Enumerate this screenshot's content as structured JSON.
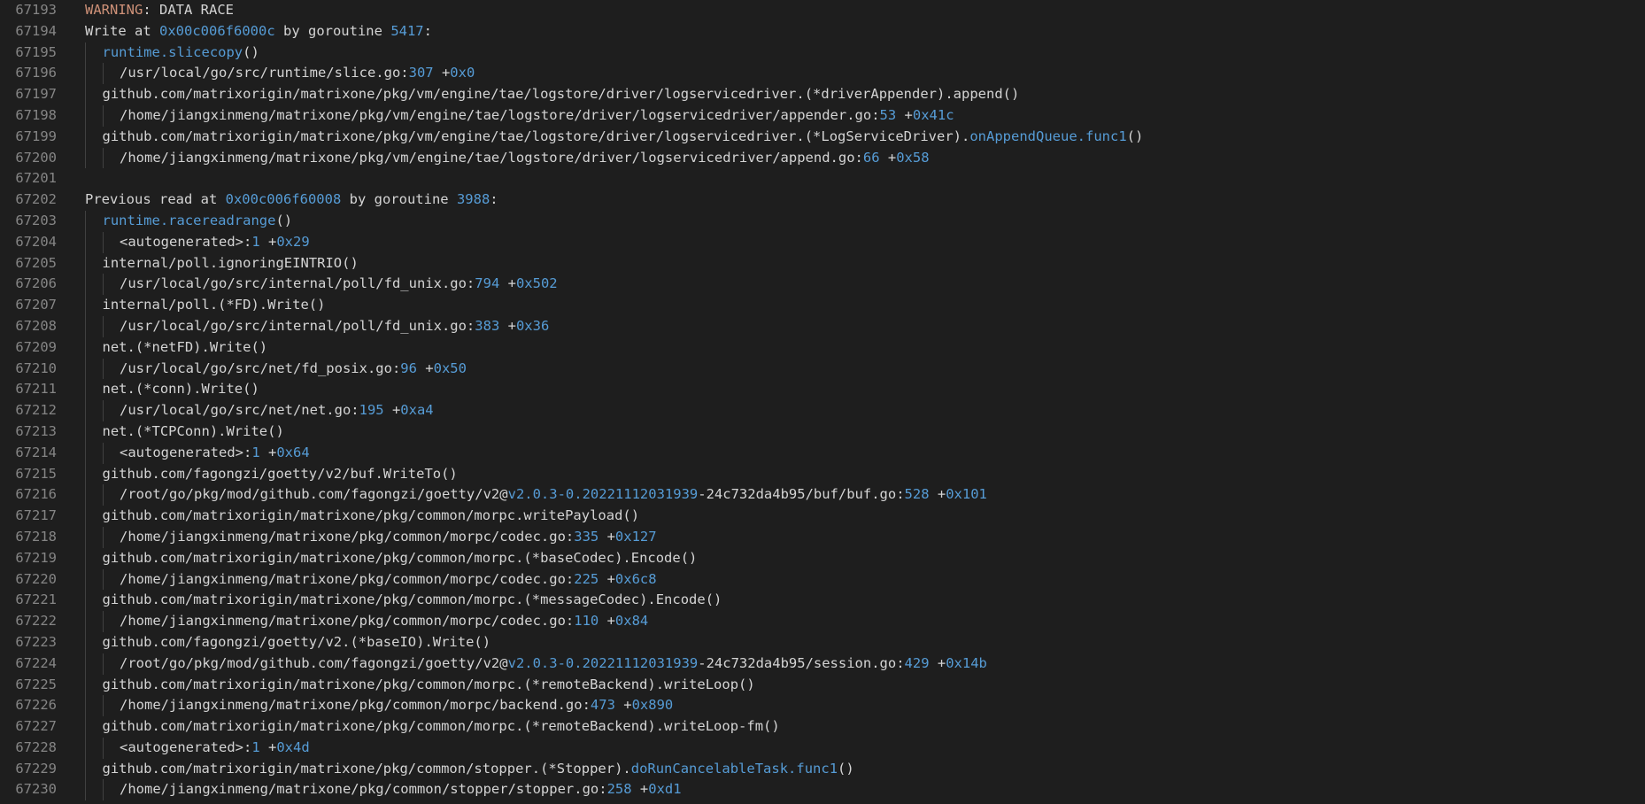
{
  "colors": {
    "background": "#1e1e1e",
    "text": "#d4d4d4",
    "line_number": "#858585",
    "highlight_blue": "#569cd6",
    "warning_orange": "#ce9178",
    "indent_guide": "#404040"
  },
  "lines": [
    {
      "n": "67193",
      "indent": 0,
      "seg": [
        {
          "t": "WARNING",
          "c": "orange"
        },
        {
          "t": ": DATA RACE",
          "c": "plain"
        }
      ]
    },
    {
      "n": "67194",
      "indent": 0,
      "seg": [
        {
          "t": "Write at ",
          "c": "plain"
        },
        {
          "t": "0x00c006f6000c",
          "c": "blue"
        },
        {
          "t": " by goroutine ",
          "c": "plain"
        },
        {
          "t": "5417",
          "c": "blue"
        },
        {
          "t": ":",
          "c": "plain"
        }
      ]
    },
    {
      "n": "67195",
      "indent": 1,
      "seg": [
        {
          "t": "runtime.slicecopy",
          "c": "blue"
        },
        {
          "t": "()",
          "c": "plain"
        }
      ]
    },
    {
      "n": "67196",
      "indent": 2,
      "seg": [
        {
          "t": "/usr/local/go/src/runtime/slice.go:",
          "c": "plain"
        },
        {
          "t": "307",
          "c": "blue"
        },
        {
          "t": " +",
          "c": "plain"
        },
        {
          "t": "0x0",
          "c": "blue"
        }
      ]
    },
    {
      "n": "67197",
      "indent": 1,
      "seg": [
        {
          "t": "github.com/matrixorigin/matrixone/pkg/vm/engine/tae/logstore/driver/logservicedriver.(*driverAppender).append()",
          "c": "plain"
        }
      ]
    },
    {
      "n": "67198",
      "indent": 2,
      "seg": [
        {
          "t": "/home/jiangxinmeng/matrixone/pkg/vm/engine/tae/logstore/driver/logservicedriver/appender.go:",
          "c": "plain"
        },
        {
          "t": "53",
          "c": "blue"
        },
        {
          "t": " +",
          "c": "plain"
        },
        {
          "t": "0x41c",
          "c": "blue"
        }
      ]
    },
    {
      "n": "67199",
      "indent": 1,
      "seg": [
        {
          "t": "github.com/matrixorigin/matrixone/pkg/vm/engine/tae/logstore/driver/logservicedriver.(*LogServiceDriver).",
          "c": "plain"
        },
        {
          "t": "onAppendQueue.func1",
          "c": "blue"
        },
        {
          "t": "()",
          "c": "plain"
        }
      ]
    },
    {
      "n": "67200",
      "indent": 2,
      "seg": [
        {
          "t": "/home/jiangxinmeng/matrixone/pkg/vm/engine/tae/logstore/driver/logservicedriver/append.go:",
          "c": "plain"
        },
        {
          "t": "66",
          "c": "blue"
        },
        {
          "t": " +",
          "c": "plain"
        },
        {
          "t": "0x58",
          "c": "blue"
        }
      ]
    },
    {
      "n": "67201",
      "indent": 0,
      "seg": []
    },
    {
      "n": "67202",
      "indent": 0,
      "seg": [
        {
          "t": "Previous read at ",
          "c": "plain"
        },
        {
          "t": "0x00c006f60008",
          "c": "blue"
        },
        {
          "t": " by goroutine ",
          "c": "plain"
        },
        {
          "t": "3988",
          "c": "blue"
        },
        {
          "t": ":",
          "c": "plain"
        }
      ]
    },
    {
      "n": "67203",
      "indent": 1,
      "seg": [
        {
          "t": "runtime.racereadrange",
          "c": "blue"
        },
        {
          "t": "()",
          "c": "plain"
        }
      ]
    },
    {
      "n": "67204",
      "indent": 2,
      "seg": [
        {
          "t": "<autogenerated>:",
          "c": "plain"
        },
        {
          "t": "1",
          "c": "blue"
        },
        {
          "t": " +",
          "c": "plain"
        },
        {
          "t": "0x29",
          "c": "blue"
        }
      ]
    },
    {
      "n": "67205",
      "indent": 1,
      "seg": [
        {
          "t": "internal/poll.ignoringEINTRIO()",
          "c": "plain"
        }
      ]
    },
    {
      "n": "67206",
      "indent": 2,
      "seg": [
        {
          "t": "/usr/local/go/src/internal/poll/fd_unix.go:",
          "c": "plain"
        },
        {
          "t": "794",
          "c": "blue"
        },
        {
          "t": " +",
          "c": "plain"
        },
        {
          "t": "0x502",
          "c": "blue"
        }
      ]
    },
    {
      "n": "67207",
      "indent": 1,
      "seg": [
        {
          "t": "internal/poll.(*FD).Write()",
          "c": "plain"
        }
      ]
    },
    {
      "n": "67208",
      "indent": 2,
      "seg": [
        {
          "t": "/usr/local/go/src/internal/poll/fd_unix.go:",
          "c": "plain"
        },
        {
          "t": "383",
          "c": "blue"
        },
        {
          "t": " +",
          "c": "plain"
        },
        {
          "t": "0x36",
          "c": "blue"
        }
      ]
    },
    {
      "n": "67209",
      "indent": 1,
      "seg": [
        {
          "t": "net.(*netFD).Write()",
          "c": "plain"
        }
      ]
    },
    {
      "n": "67210",
      "indent": 2,
      "seg": [
        {
          "t": "/usr/local/go/src/net/fd_posix.go:",
          "c": "plain"
        },
        {
          "t": "96",
          "c": "blue"
        },
        {
          "t": " +",
          "c": "plain"
        },
        {
          "t": "0x50",
          "c": "blue"
        }
      ]
    },
    {
      "n": "67211",
      "indent": 1,
      "seg": [
        {
          "t": "net.(*conn).Write()",
          "c": "plain"
        }
      ]
    },
    {
      "n": "67212",
      "indent": 2,
      "seg": [
        {
          "t": "/usr/local/go/src/net/net.go:",
          "c": "plain"
        },
        {
          "t": "195",
          "c": "blue"
        },
        {
          "t": " +",
          "c": "plain"
        },
        {
          "t": "0xa4",
          "c": "blue"
        }
      ]
    },
    {
      "n": "67213",
      "indent": 1,
      "seg": [
        {
          "t": "net.(*TCPConn).Write()",
          "c": "plain"
        }
      ]
    },
    {
      "n": "67214",
      "indent": 2,
      "seg": [
        {
          "t": "<autogenerated>:",
          "c": "plain"
        },
        {
          "t": "1",
          "c": "blue"
        },
        {
          "t": " +",
          "c": "plain"
        },
        {
          "t": "0x64",
          "c": "blue"
        }
      ]
    },
    {
      "n": "67215",
      "indent": 1,
      "seg": [
        {
          "t": "github.com/fagongzi/goetty/v2/buf.WriteTo()",
          "c": "plain"
        }
      ]
    },
    {
      "n": "67216",
      "indent": 2,
      "seg": [
        {
          "t": "/root/go/pkg/mod/github.com/fagongzi/goetty/v2@",
          "c": "plain"
        },
        {
          "t": "v2.0.3-0.20221112031939",
          "c": "blue"
        },
        {
          "t": "-24c732da4b95/buf/buf.go:",
          "c": "plain"
        },
        {
          "t": "528",
          "c": "blue"
        },
        {
          "t": " +",
          "c": "plain"
        },
        {
          "t": "0x101",
          "c": "blue"
        }
      ]
    },
    {
      "n": "67217",
      "indent": 1,
      "seg": [
        {
          "t": "github.com/matrixorigin/matrixone/pkg/common/morpc.writePayload()",
          "c": "plain"
        }
      ]
    },
    {
      "n": "67218",
      "indent": 2,
      "seg": [
        {
          "t": "/home/jiangxinmeng/matrixone/pkg/common/morpc/codec.go:",
          "c": "plain"
        },
        {
          "t": "335",
          "c": "blue"
        },
        {
          "t": " +",
          "c": "plain"
        },
        {
          "t": "0x127",
          "c": "blue"
        }
      ]
    },
    {
      "n": "67219",
      "indent": 1,
      "seg": [
        {
          "t": "github.com/matrixorigin/matrixone/pkg/common/morpc.(*baseCodec).Encode()",
          "c": "plain"
        }
      ]
    },
    {
      "n": "67220",
      "indent": 2,
      "seg": [
        {
          "t": "/home/jiangxinmeng/matrixone/pkg/common/morpc/codec.go:",
          "c": "plain"
        },
        {
          "t": "225",
          "c": "blue"
        },
        {
          "t": " +",
          "c": "plain"
        },
        {
          "t": "0x6c8",
          "c": "blue"
        }
      ]
    },
    {
      "n": "67221",
      "indent": 1,
      "seg": [
        {
          "t": "github.com/matrixorigin/matrixone/pkg/common/morpc.(*messageCodec).Encode()",
          "c": "plain"
        }
      ]
    },
    {
      "n": "67222",
      "indent": 2,
      "seg": [
        {
          "t": "/home/jiangxinmeng/matrixone/pkg/common/morpc/codec.go:",
          "c": "plain"
        },
        {
          "t": "110",
          "c": "blue"
        },
        {
          "t": " +",
          "c": "plain"
        },
        {
          "t": "0x84",
          "c": "blue"
        }
      ]
    },
    {
      "n": "67223",
      "indent": 1,
      "seg": [
        {
          "t": "github.com/fagongzi/goetty/v2.(*baseIO).Write()",
          "c": "plain"
        }
      ]
    },
    {
      "n": "67224",
      "indent": 2,
      "seg": [
        {
          "t": "/root/go/pkg/mod/github.com/fagongzi/goetty/v2@",
          "c": "plain"
        },
        {
          "t": "v2.0.3-0.20221112031939",
          "c": "blue"
        },
        {
          "t": "-24c732da4b95/session.go:",
          "c": "plain"
        },
        {
          "t": "429",
          "c": "blue"
        },
        {
          "t": " +",
          "c": "plain"
        },
        {
          "t": "0x14b",
          "c": "blue"
        }
      ]
    },
    {
      "n": "67225",
      "indent": 1,
      "seg": [
        {
          "t": "github.com/matrixorigin/matrixone/pkg/common/morpc.(*remoteBackend).writeLoop()",
          "c": "plain"
        }
      ]
    },
    {
      "n": "67226",
      "indent": 2,
      "seg": [
        {
          "t": "/home/jiangxinmeng/matrixone/pkg/common/morpc/backend.go:",
          "c": "plain"
        },
        {
          "t": "473",
          "c": "blue"
        },
        {
          "t": " +",
          "c": "plain"
        },
        {
          "t": "0x890",
          "c": "blue"
        }
      ]
    },
    {
      "n": "67227",
      "indent": 1,
      "seg": [
        {
          "t": "github.com/matrixorigin/matrixone/pkg/common/morpc.(*remoteBackend).writeLoop-fm()",
          "c": "plain"
        }
      ]
    },
    {
      "n": "67228",
      "indent": 2,
      "seg": [
        {
          "t": "<autogenerated>:",
          "c": "plain"
        },
        {
          "t": "1",
          "c": "blue"
        },
        {
          "t": " +",
          "c": "plain"
        },
        {
          "t": "0x4d",
          "c": "blue"
        }
      ]
    },
    {
      "n": "67229",
      "indent": 1,
      "seg": [
        {
          "t": "github.com/matrixorigin/matrixone/pkg/common/stopper.(*Stopper).",
          "c": "plain"
        },
        {
          "t": "doRunCancelableTask.func1",
          "c": "blue"
        },
        {
          "t": "()",
          "c": "plain"
        }
      ]
    },
    {
      "n": "67230",
      "indent": 2,
      "seg": [
        {
          "t": "/home/jiangxinmeng/matrixone/pkg/common/stopper/stopper.go:",
          "c": "plain"
        },
        {
          "t": "258",
          "c": "blue"
        },
        {
          "t": " +",
          "c": "plain"
        },
        {
          "t": "0xd1",
          "c": "blue"
        }
      ]
    }
  ]
}
